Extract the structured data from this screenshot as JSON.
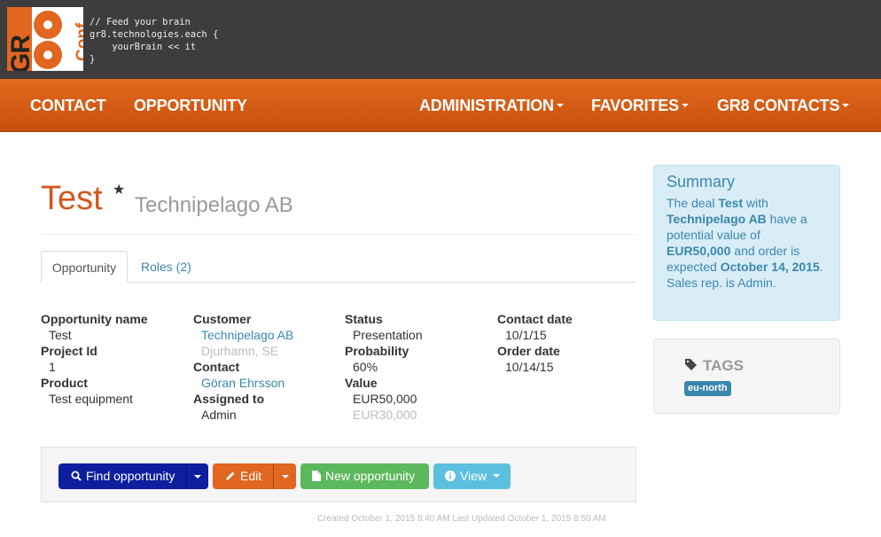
{
  "logo": {
    "letters": "GR",
    "suffix": "Conf"
  },
  "code_lines": [
    "// Feed your brain",
    "gr8.technologies.each {",
    "    yourBrain << it",
    "}"
  ],
  "nav": {
    "contact": "CONTACT",
    "opportunity": "OPPORTUNITY",
    "administration": "ADMINISTRATION",
    "favorites": "FAVORITES",
    "gr8_contacts": "GR8 CONTACTS"
  },
  "header": {
    "title": "Test",
    "star": "★",
    "subtitle": "Technipelago AB"
  },
  "tabs": {
    "opportunity": "Opportunity",
    "roles": "Roles (2)"
  },
  "details": {
    "opportunity_name_label": "Opportunity name",
    "opportunity_name": "Test",
    "project_id_label": "Project Id",
    "project_id": "1",
    "product_label": "Product",
    "product": "Test equipment",
    "customer_label": "Customer",
    "customer": "Technipelago AB",
    "customer_location": "Djurhamn, SE",
    "contact_label": "Contact",
    "contact": "Göran Ehrsson",
    "assigned_label": "Assigned to",
    "assigned": "Admin",
    "status_label": "Status",
    "status": "Presentation",
    "probability_label": "Probability",
    "probability": "60%",
    "value_label": "Value",
    "value": "EUR50,000",
    "value_weighted": "EUR30,000",
    "contact_date_label": "Contact date",
    "contact_date": "10/1/15",
    "order_date_label": "Order date",
    "order_date": "10/14/15"
  },
  "actions": {
    "find": "Find opportunity",
    "edit": "Edit",
    "new": "New opportunity",
    "view": "View"
  },
  "footer": "Created October 1, 2015 8:40 AM Last Updated October 1, 2015 8:50 AM",
  "summary": {
    "heading": "Summary",
    "t1": "The deal ",
    "deal": "Test",
    "t2": " with ",
    "company": "Technipelago AB",
    "t3": " have a potential value of ",
    "value": "EUR50,000",
    "t4": " and order is expected ",
    "date": "October 14, 2015",
    "t5": ". Sales rep. is Admin."
  },
  "tags": {
    "heading": "TAGS",
    "items": [
      "eu-north"
    ]
  },
  "colors": {
    "brand_orange": "#d2581c",
    "nav_top": "#e0691d",
    "nav_bottom": "#c9500d",
    "btn_find": "#0d1e9e",
    "btn_edit": "#e1661f",
    "btn_new": "#5cb85c",
    "btn_view": "#5bc0de",
    "link": "#3a87ad"
  }
}
